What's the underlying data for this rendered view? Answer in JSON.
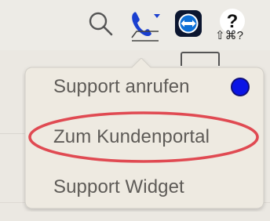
{
  "toolbar": {
    "icons": [
      "search-icon",
      "phone-support-icon",
      "teamviewer-icon",
      "help-icon"
    ],
    "help_shortcut": "⇧⌘?"
  },
  "menu": {
    "items": [
      {
        "label": "Support anrufen",
        "status_dot": true
      },
      {
        "label": "Zum Kundenportal",
        "highlighted": true
      },
      {
        "label": "Support Widget"
      }
    ]
  },
  "colors": {
    "menu_bg": "#eeeae1",
    "menu_text": "#5e5b57",
    "status_dot": "#0a14e6",
    "highlight_ring": "#e04a52",
    "teamviewer_blue": "#0e6fd6",
    "phone_blue": "#1a3fd0"
  }
}
